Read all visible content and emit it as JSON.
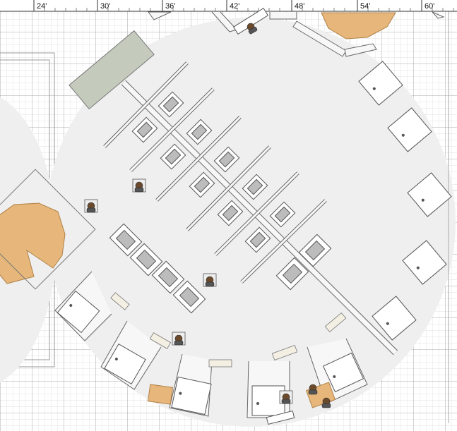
{
  "ruler": {
    "ticks": [
      "24'",
      "30'",
      "36'",
      "42'",
      "48'",
      "54'",
      "60'"
    ]
  },
  "colors": {
    "page": "#ffffff",
    "grid_minor": "#d9d9d9",
    "grid_major": "#aaaaaa",
    "floor": "#efefef",
    "wall_fill": "#f7f7f7",
    "wall_stroke": "#666666",
    "desk_fill": "#ffffff",
    "monitor_fill": "#bcbcbc",
    "counter_fill": "#c4cbbd",
    "wood_fill": "#e6b67a",
    "person_hair": "#6b4a2c"
  },
  "icons": [
    "person-icon",
    "chair-icon",
    "desk-icon",
    "monitor-icon",
    "door-icon",
    "plant-icon"
  ]
}
